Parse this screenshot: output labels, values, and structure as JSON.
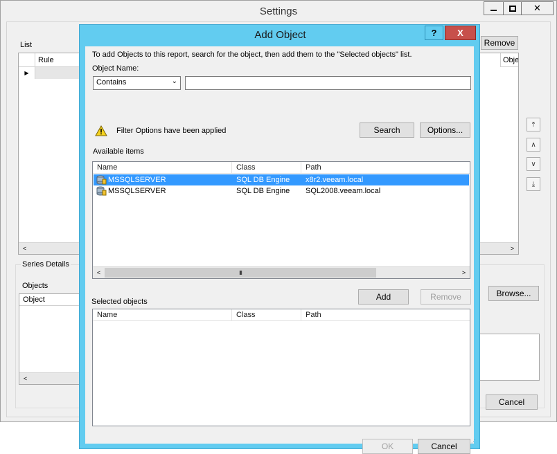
{
  "settings_window": {
    "title": "Settings",
    "list_label": "List",
    "list_columns": [
      "Rule",
      "Obje"
    ],
    "remove_label": "Remove",
    "series_details_label": "Series Details",
    "objects_label": "Objects",
    "object_column": "Object",
    "browse_label": "Browse...",
    "cancel_label": "Cancel"
  },
  "dialog": {
    "title": "Add Object",
    "help_glyph": "?",
    "close_glyph": "X",
    "instructions": "To add Objects to this report, search for the object, then add them to the \"Selected objects\" list.",
    "object_name_label": "Object Name:",
    "filter_select": {
      "value": "Contains"
    },
    "search_input": {
      "value": ""
    },
    "filter_message": "Filter Options have been applied",
    "search_label": "Search",
    "options_label": "Options...",
    "available_items_label": "Available items",
    "columns": [
      "Name",
      "Class",
      "Path"
    ],
    "available_items": [
      {
        "name": "MSSQLSERVER",
        "class": "SQL DB Engine",
        "path": "x8r2.veeam.local",
        "selected": true
      },
      {
        "name": "MSSQLSERVER",
        "class": "SQL DB Engine",
        "path": "SQL2008.veeam.local",
        "selected": false
      }
    ],
    "scroll_grip": "III",
    "add_label": "Add",
    "remove_label": "Remove",
    "selected_objects_label": "Selected objects",
    "ok_label": "OK",
    "cancel_label": "Cancel"
  },
  "colors": {
    "dialog_frame": "#62ccf0",
    "close_button": "#c7504b",
    "selection": "#3399ff"
  }
}
